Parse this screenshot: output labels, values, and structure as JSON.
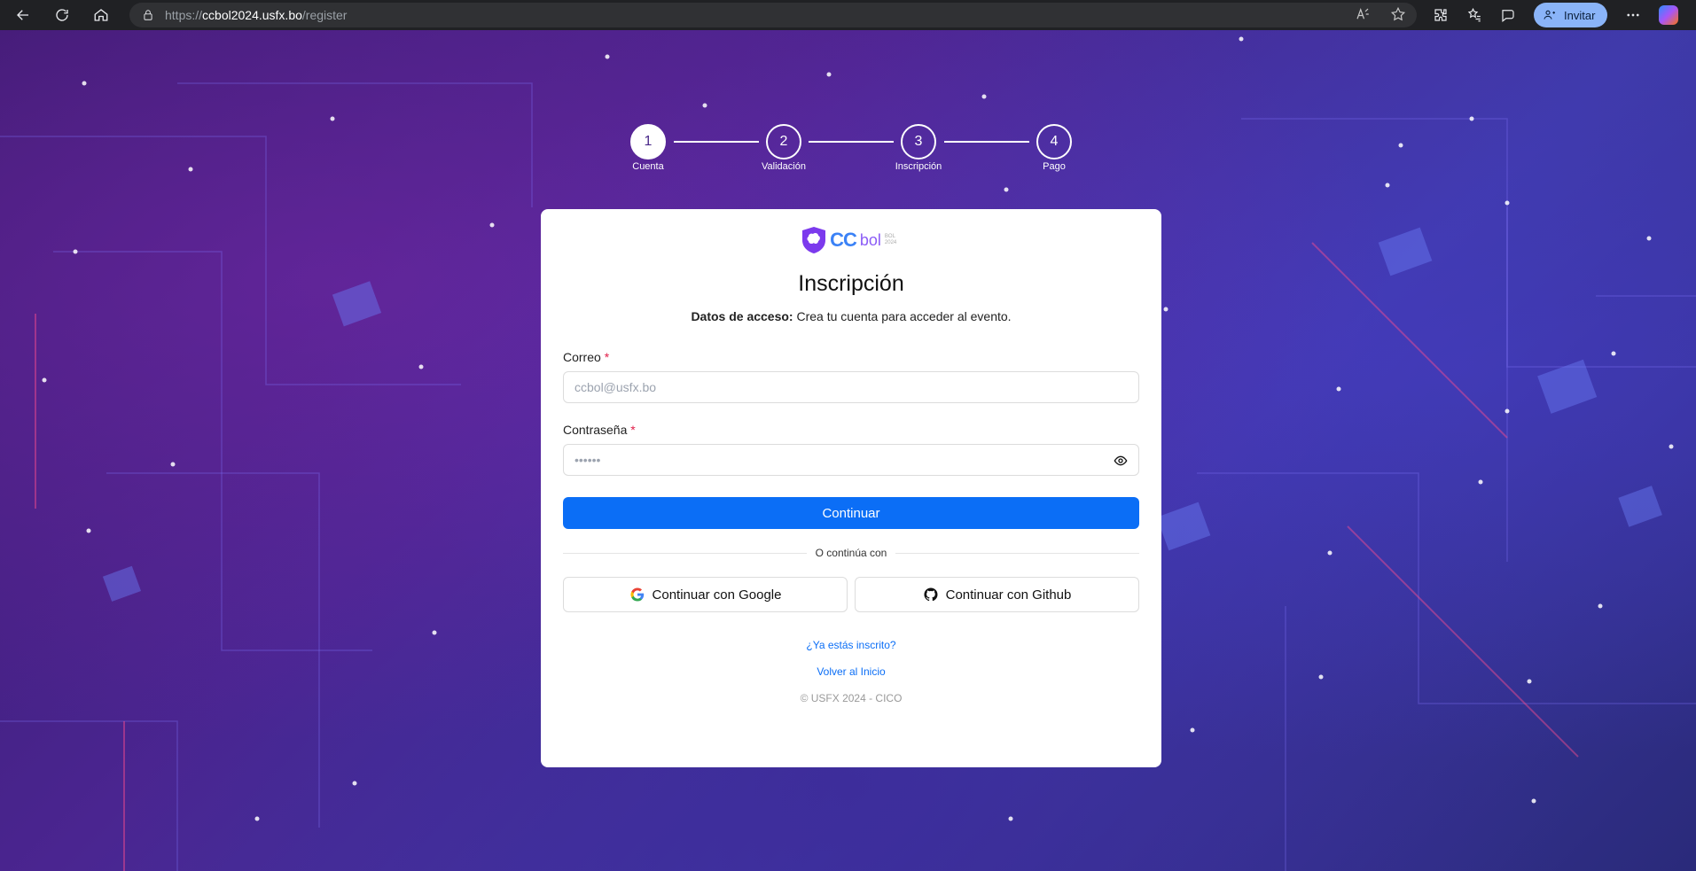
{
  "browser": {
    "url_protocol": "https://",
    "url_host": "ccbol2024.usfx.bo",
    "url_path": "/register",
    "invite_label": "Invitar"
  },
  "stepper": {
    "steps": [
      {
        "number": "1",
        "label": "Cuenta",
        "active": true
      },
      {
        "number": "2",
        "label": "Validación",
        "active": false
      },
      {
        "number": "3",
        "label": "Inscripción",
        "active": false
      },
      {
        "number": "4",
        "label": "Pago",
        "active": false
      }
    ]
  },
  "logo": {
    "cc": "CC",
    "bol": "bol",
    "sub": "BOL 2024"
  },
  "form": {
    "title": "Inscripción",
    "subtitle_bold": "Datos de acceso:",
    "subtitle_rest": " Crea tu cuenta para acceder al evento.",
    "email_label": "Correo",
    "email_placeholder": "ccbol@usfx.bo",
    "password_label": "Contraseña",
    "password_placeholder": "••••••",
    "required_mark": "*",
    "submit_label": "Continuar",
    "divider_text": "O continúa con",
    "google_label": "Continuar con Google",
    "github_label": "Continuar con Github",
    "login_link": "¿Ya estás inscrito?",
    "home_link": "Volver al Inicio",
    "footer": "© USFX 2024 - CICO"
  },
  "colors": {
    "primary": "#0b6ef6",
    "background": "#3f2a8a"
  }
}
